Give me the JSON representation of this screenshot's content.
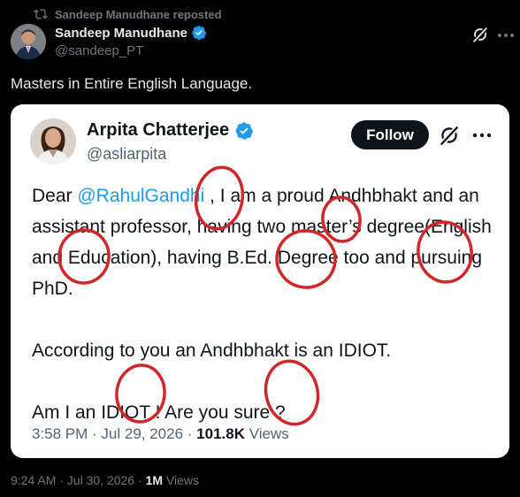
{
  "repost": {
    "label": "Sandeep Manudhane reposted",
    "icon": "repost-icon"
  },
  "author": {
    "name": "Sandeep Manudhane",
    "handle": "@sandeep_PT",
    "verified_color": "#1d9bf0"
  },
  "tweet": {
    "text": "Masters in Entire English Language."
  },
  "quoted": {
    "author": {
      "name": "Arpita Chatterjee",
      "handle": "@asliarpita"
    },
    "follow_label": "Follow",
    "line1_pre": "Dear ",
    "mention": "@RahulGandhi",
    "line1_post": " , I am a proud Andhbhakt and an assistant professor, having two master’s degree(English and Education), having B.Ed. Degree too and pursuing PhD.",
    "para2": "According to you an Andhbhakt is an IDIOT.",
    "para3": "Am I an IDIOT ! Are you sure ?",
    "time": "3:58 PM · Jul 29, 2026 · ",
    "views_count": "101.8K",
    "views_label": " Views"
  },
  "meta": {
    "time": "9:24 AM · Jul 30, 2026 · ",
    "views_count": "1M",
    "views_label": " Views"
  },
  "colors": {
    "accent": "#1d9bf0",
    "annotation": "#d0272b",
    "background": "#000000",
    "card": "#ffffff"
  }
}
